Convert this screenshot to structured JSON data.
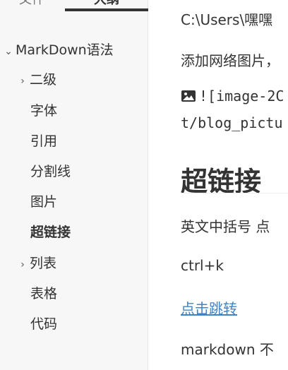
{
  "sidebar": {
    "tabs": [
      {
        "label": "文件"
      },
      {
        "label": "大纲"
      }
    ],
    "outline": [
      {
        "label": "MarkDown语法",
        "chevron": "⌄"
      },
      {
        "label": "二级",
        "chevron": "›"
      },
      {
        "label": "字体"
      },
      {
        "label": "引用"
      },
      {
        "label": "分割线"
      },
      {
        "label": "图片"
      },
      {
        "label": "超链接",
        "active": true
      },
      {
        "label": "列表",
        "chevron": "›"
      },
      {
        "label": "表格"
      },
      {
        "label": "代码"
      }
    ]
  },
  "editor": {
    "path_line": "C:\\Users\\嘿嘿",
    "add_image_text": "添加网络图片，",
    "image_md_line1": "![image-2C",
    "image_md_line2": "t/blog_pictu",
    "heading": "超链接",
    "para1": "英文中括号 点",
    "shortcut": "ctrl+k",
    "link_text": "点击跳转",
    "para2": "markdown 不"
  },
  "icons": {
    "image": "broken-image-icon",
    "chevron_down": "chevron-down-icon",
    "chevron_right": "chevron-right-icon"
  },
  "colors": {
    "link": "#4183c4",
    "sidebar_bg": "#f7f7f7",
    "text": "#333333"
  }
}
